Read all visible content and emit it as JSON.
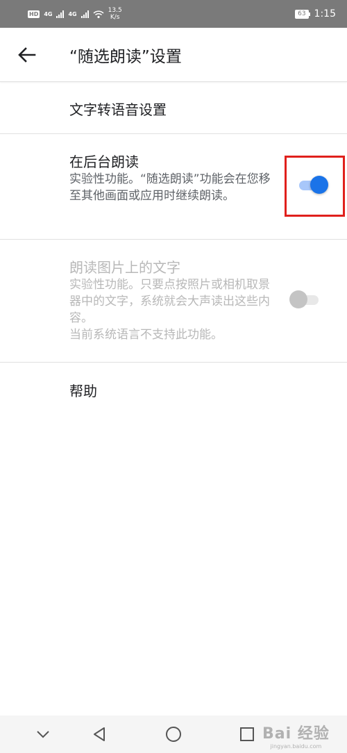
{
  "status_bar": {
    "hd": "HD",
    "net1": "4G",
    "net2": "4G",
    "speed_value": "13.5",
    "speed_unit": "K/s",
    "battery": "63",
    "time": "1:15"
  },
  "app_bar": {
    "title": "“随选朗读”设置",
    "back_icon": "arrow-left-icon"
  },
  "settings": {
    "tts": {
      "title": "文字转语音设置"
    },
    "background": {
      "title": "在后台朗读",
      "description": "实验性功能。“随选朗读”功能会在您移至其他画面或应用时继续朗读。",
      "enabled": true
    },
    "image_text": {
      "title": "朗读图片上的文字",
      "description": "实验性功能。只要点按照片或相机取景器中的文字，系统就会大声读出这些内容。",
      "note": "当前系统语言不支持此功能。",
      "enabled": false,
      "disabled": true
    },
    "help": {
      "title": "帮助"
    }
  },
  "nav_bar": {
    "icons": [
      "chevron-down-icon",
      "back-triangle-icon",
      "home-circle-icon",
      "recents-square-icon"
    ]
  },
  "watermark": {
    "main": "Bai 经验",
    "sub": "jingyan.baidu.com"
  },
  "colors": {
    "accent": "#1a73e8",
    "highlight": "#e0201c",
    "status_bar": "#7a7a7a"
  }
}
